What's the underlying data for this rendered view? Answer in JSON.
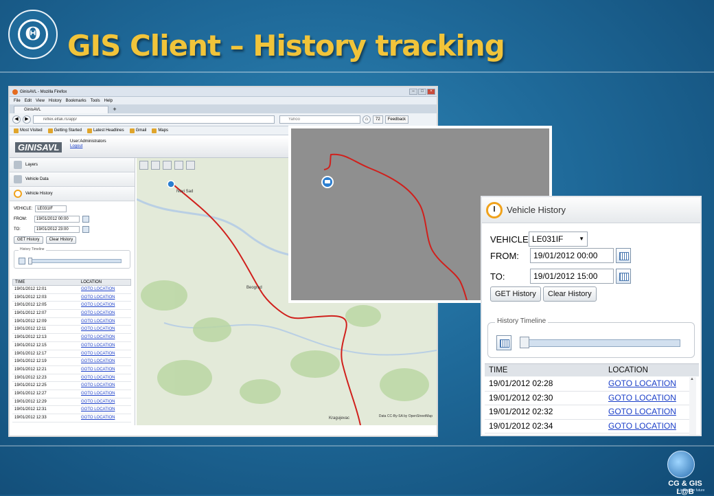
{
  "slide": {
    "title": "GIS Client – History tracking",
    "lab_logo_text": "CG & GIS L@B",
    "lab_logo_sub": "Linking the future",
    "university_logo_char": "Θ"
  },
  "browser": {
    "window_title": "GinisAVL - Mozilla Firefox",
    "menu": [
      "File",
      "Edit",
      "View",
      "History",
      "Bookmarks",
      "Tools",
      "Help"
    ],
    "tab_title": "GinisAVL",
    "url": "reflex.elfak.rs/app/",
    "search_placeholder": "Yahoo",
    "mail_count": "72",
    "feedback_label": "Feedback",
    "bookmarks": [
      "Most Visited",
      "Getting Started",
      "Latest Headlines",
      "Gmail",
      "Maps"
    ]
  },
  "app": {
    "logo": "GINISAVL",
    "user_line": "User:Administrators",
    "logout_label": "Logout",
    "accordion": [
      "Layers",
      "Vehicle Data",
      "Vehicle History"
    ],
    "vehicle_label": "VEHICLE:",
    "vehicle_value": "LE031IF",
    "from_label": "FROM:",
    "from_value": "19/01/2012 00:00",
    "to_label": "TO:",
    "to_value": "19/01/2012 23:00",
    "get_history_label": "GET History",
    "clear_history_label": "Clear History",
    "timeline_legend": "History Timeline",
    "col_time": "TIME",
    "col_location": "LOCATION",
    "rows": [
      {
        "time": "19/01/2012 12:01",
        "loc": "GOTO LOCATION"
      },
      {
        "time": "19/01/2012 12:03",
        "loc": "GOTO LOCATION"
      },
      {
        "time": "19/01/2012 12:05",
        "loc": "GOTO LOCATION"
      },
      {
        "time": "19/01/2012 12:07",
        "loc": "GOTO LOCATION"
      },
      {
        "time": "19/01/2012 12:09",
        "loc": "GOTO LOCATION"
      },
      {
        "time": "19/01/2012 12:11",
        "loc": "GOTO LOCATION"
      },
      {
        "time": "19/01/2012 12:13",
        "loc": "GOTO LOCATION"
      },
      {
        "time": "19/01/2012 12:15",
        "loc": "GOTO LOCATION"
      },
      {
        "time": "19/01/2012 12:17",
        "loc": "GOTO LOCATION"
      },
      {
        "time": "19/01/2012 12:19",
        "loc": "GOTO LOCATION"
      },
      {
        "time": "19/01/2012 12:21",
        "loc": "GOTO LOCATION"
      },
      {
        "time": "19/01/2012 12:23",
        "loc": "GOTO LOCATION"
      },
      {
        "time": "19/01/2012 12:25",
        "loc": "GOTO LOCATION"
      },
      {
        "time": "19/01/2012 12:27",
        "loc": "GOTO LOCATION"
      },
      {
        "time": "19/01/2012 12:29",
        "loc": "GOTO LOCATION"
      },
      {
        "time": "19/01/2012 12:31",
        "loc": "GOTO LOCATION"
      },
      {
        "time": "19/01/2012 12:33",
        "loc": "GOTO LOCATION"
      }
    ],
    "map_labels": [
      "Novi Sad",
      "Beograd",
      "Kragujevac"
    ],
    "map_attribution": "Data CC-By-SA by OpenStreetMap",
    "status_close": "✕"
  },
  "zoom_panel": {
    "title": "Vehicle History",
    "vehicle_label": "VEHICLE:",
    "vehicle_value": "LE031IF",
    "from_label": "FROM:",
    "from_value": "19/01/2012 00:00",
    "to_label": "TO:",
    "to_value": "19/01/2012 15:00",
    "get_history_label": "GET History",
    "clear_history_label": "Clear History",
    "timeline_legend": "History Timeline",
    "col_time": "TIME",
    "col_location": "LOCATION",
    "rows": [
      {
        "time": "19/01/2012 02:28",
        "loc": "GOTO LOCATION"
      },
      {
        "time": "19/01/2012 02:30",
        "loc": "GOTO LOCATION"
      },
      {
        "time": "19/01/2012 02:32",
        "loc": "GOTO LOCATION"
      },
      {
        "time": "19/01/2012 02:34",
        "loc": "GOTO LOCATION"
      }
    ]
  },
  "colors": {
    "title": "#f1c43a",
    "route": "#d0201c",
    "link": "#1a3ec8",
    "background": "#1f6a9a"
  }
}
